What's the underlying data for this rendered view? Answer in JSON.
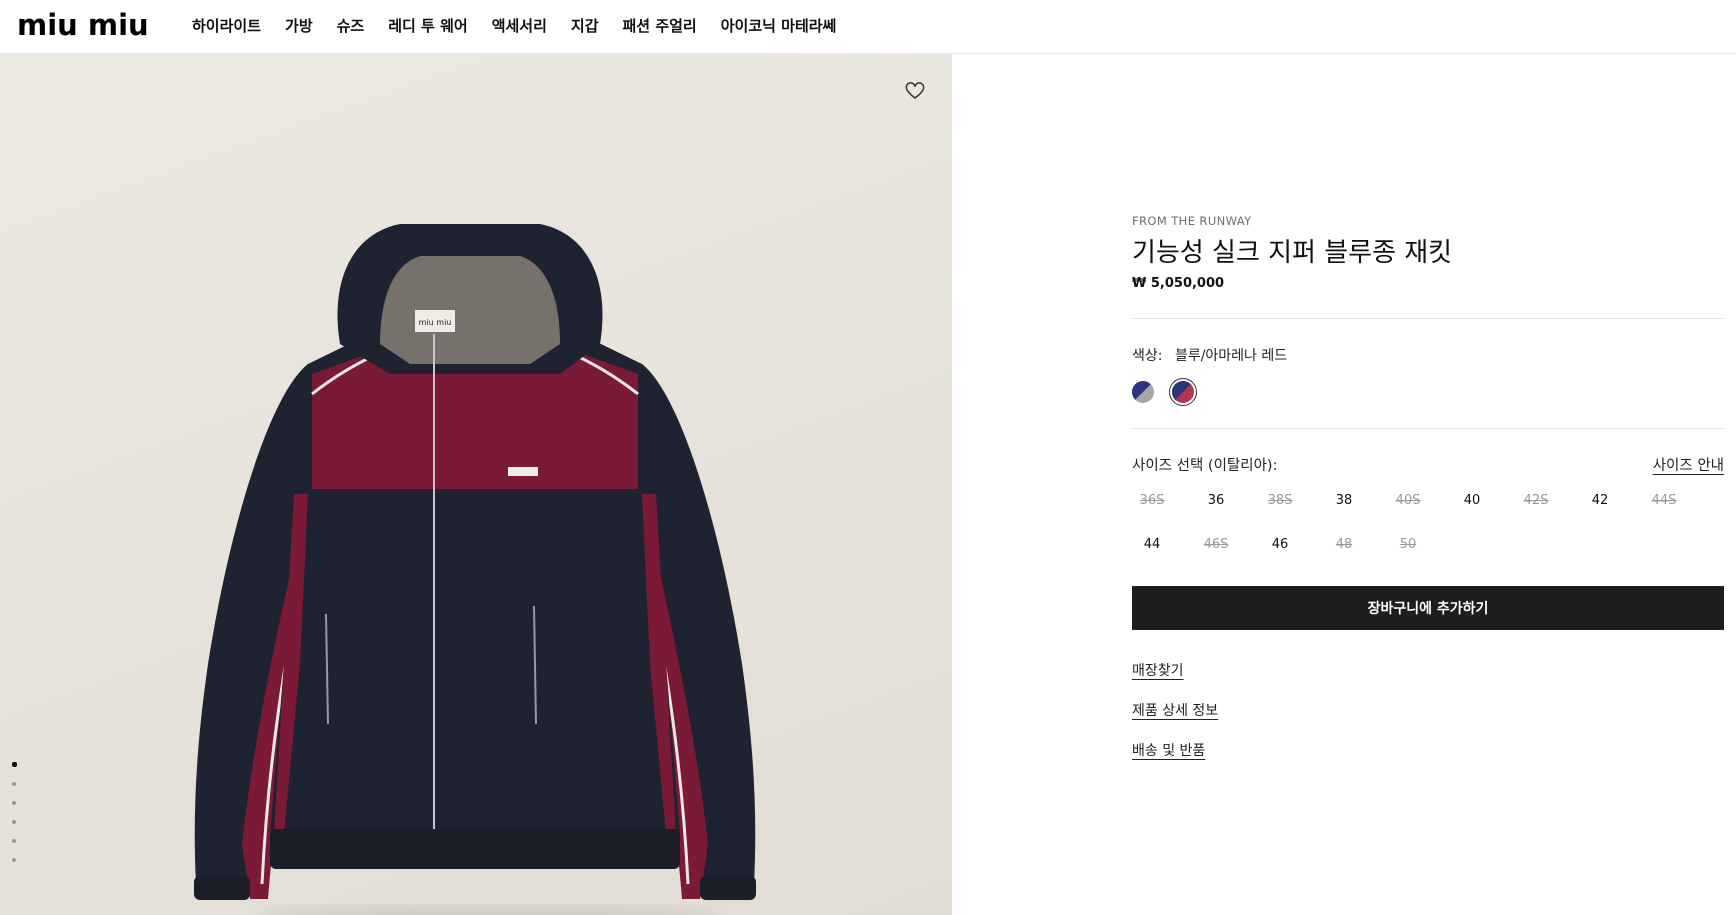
{
  "brand": {
    "logo_text": "miu miu"
  },
  "nav": {
    "items": [
      "하이라이트",
      "가방",
      "슈즈",
      "레디 투 웨어",
      "액세서리",
      "지갑",
      "패션 주얼리",
      "아이코닉 마테라쎄"
    ]
  },
  "gallery": {
    "favorite_icon": "heart-outline-icon",
    "image_count": 6,
    "active_index": 0,
    "background_color": "#e8e5de",
    "jacket_colors": {
      "body": "#1f2230",
      "panel": "#7a1a36",
      "hood_lining": "#77716b",
      "piping": "#e8e8e8"
    }
  },
  "product": {
    "eyebrow": "FROM THE RUNWAY",
    "title": "기능성 실크 지퍼 블루종 재킷",
    "price": "₩ 5,050,000",
    "color_label": "색상:",
    "color_value": "블루/아마레나 레드",
    "swatches": [
      {
        "name": "blue-grey",
        "colors": [
          "#2e3478",
          "#a7a7a7"
        ],
        "selected": false
      },
      {
        "name": "blue-amarena-red",
        "colors": [
          "#2e3478",
          "#b2364c"
        ],
        "selected": true
      }
    ],
    "size_label": "사이즈 선택 (이탈리아):",
    "size_guide": "사이즈 안내",
    "sizes": [
      {
        "label": "36S",
        "available": false
      },
      {
        "label": "36",
        "available": true
      },
      {
        "label": "38S",
        "available": false
      },
      {
        "label": "38",
        "available": true
      },
      {
        "label": "40S",
        "available": false
      },
      {
        "label": "40",
        "available": true
      },
      {
        "label": "42S",
        "available": false
      },
      {
        "label": "42",
        "available": true
      },
      {
        "label": "44S",
        "available": false
      },
      {
        "label": "44",
        "available": true
      },
      {
        "label": "46S",
        "available": false
      },
      {
        "label": "46",
        "available": true
      },
      {
        "label": "48",
        "available": false
      },
      {
        "label": "50",
        "available": false
      }
    ],
    "add_to_cart": "장바구니에 추가하기",
    "links": [
      "매장찾기",
      "제품 상세 정보",
      "배송 및 반품"
    ]
  }
}
